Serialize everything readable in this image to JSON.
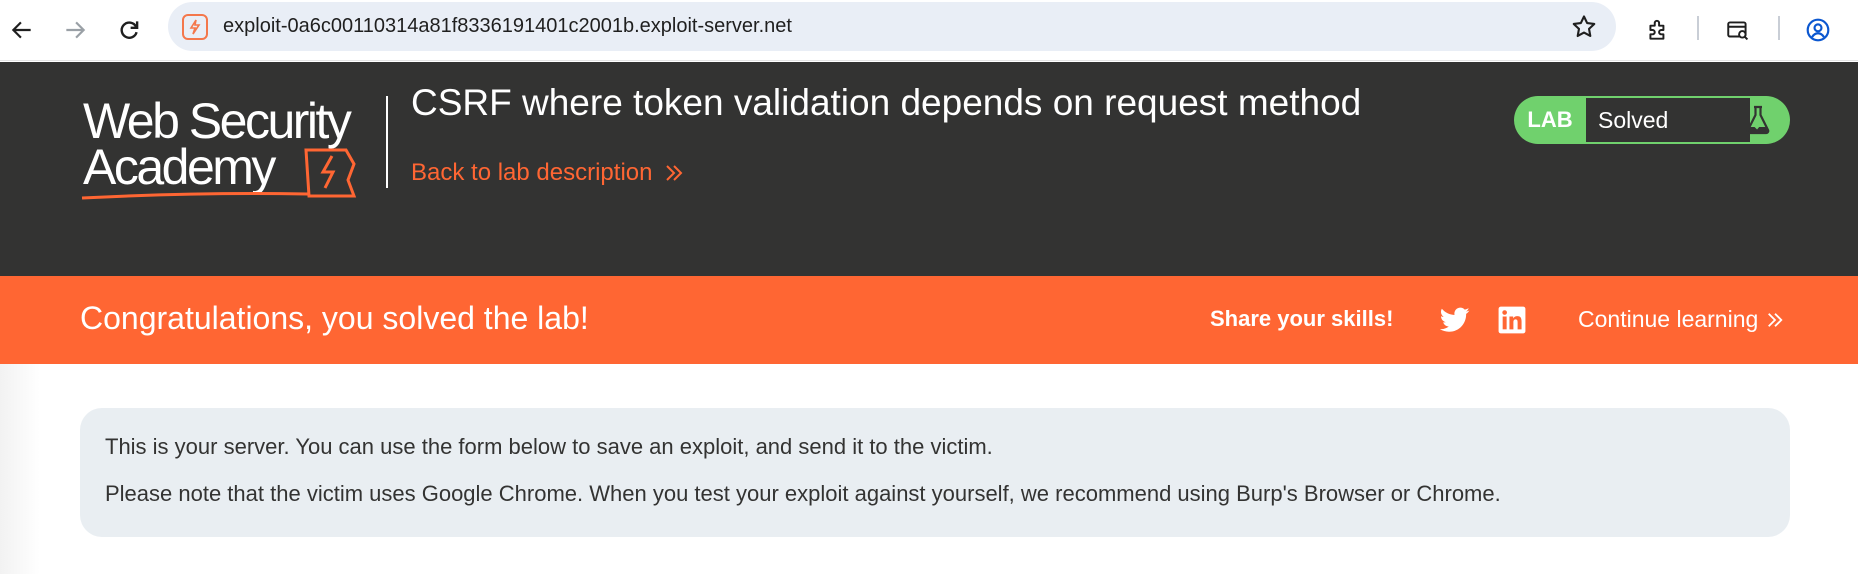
{
  "browser": {
    "url": "exploit-0a6c00110314a81f8336191401c2001b.exploit-server.net"
  },
  "header": {
    "logo_text": "Web Security Academy",
    "lab_title": "CSRF where token validation depends on request method",
    "back_link": "Back to lab description"
  },
  "status": {
    "badge": "LAB",
    "text": "Solved"
  },
  "banner": {
    "congrats": "Congratulations, you solved the lab!",
    "share": "Share your skills!",
    "continue": "Continue learning"
  },
  "info": {
    "line1": "This is your server. You can use the form below to save an exploit, and send it to the victim.",
    "line2": "Please note that the victim uses Google Chrome. When you test your exploit against yourself, we recommend using Burp's Browser or Chrome."
  },
  "colors": {
    "header_bg": "#333332",
    "brand_orange": "#ff6633",
    "solved_green": "#70d16d",
    "info_bg": "#e9eef2"
  }
}
